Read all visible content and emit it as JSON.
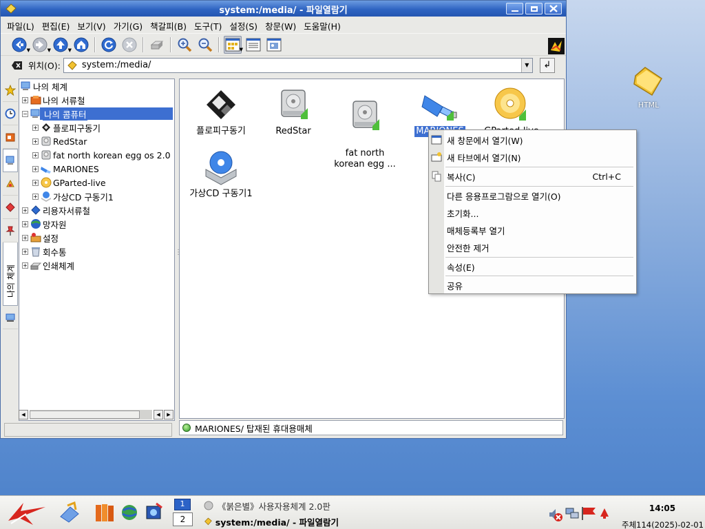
{
  "window": {
    "title": "system:/media/ - 파일열람기"
  },
  "menu": [
    "파일(L)",
    "편집(E)",
    "보기(V)",
    "가기(G)",
    "책갈피(B)",
    "도구(T)",
    "설정(S)",
    "창문(W)",
    "도움말(H)"
  ],
  "toolbar": {
    "icons": [
      "back-icon",
      "forward-icon",
      "up-icon",
      "home-icon",
      "reload-icon",
      "stop-icon",
      "print-icon",
      "zoom-in-icon",
      "zoom-out-icon",
      "icon-view-icon",
      "detail-view-icon",
      "preview-icon"
    ]
  },
  "location": {
    "label": "위치(O):",
    "value": "system:/media/"
  },
  "sidetab": {
    "label": "나의 체계"
  },
  "tree": {
    "root": "나의 체계",
    "items": [
      {
        "label": "나의 서류철",
        "depth": 1
      },
      {
        "label": "나의 콤퓨터",
        "depth": 1,
        "selected": true
      },
      {
        "label": "플로피구동기",
        "depth": 2
      },
      {
        "label": "RedStar",
        "depth": 2
      },
      {
        "label": "fat north korean egg os 2.0",
        "depth": 2
      },
      {
        "label": "MARIONES",
        "depth": 2
      },
      {
        "label": "GParted-live",
        "depth": 2
      },
      {
        "label": "가상CD 구동기1",
        "depth": 2
      },
      {
        "label": "리용자서류철",
        "depth": 1
      },
      {
        "label": "망자원",
        "depth": 1
      },
      {
        "label": "설정",
        "depth": 1
      },
      {
        "label": "회수통",
        "depth": 1
      },
      {
        "label": "인쇄체계",
        "depth": 1
      }
    ]
  },
  "icons": [
    {
      "label": "플로피구동기",
      "icon": "floppy-icon"
    },
    {
      "label": "RedStar",
      "icon": "hard-disk-icon"
    },
    {
      "label": "fat north\nkorean egg ...",
      "icon": "hard-disk-icon"
    },
    {
      "label": "MARIONES",
      "icon": "usb-drive-icon",
      "selected": true
    },
    {
      "label": "GParted-live",
      "icon": "cdrom-icon"
    },
    {
      "label": "가상CD 구동기1",
      "icon": "virtual-cd-icon"
    }
  ],
  "status": {
    "text": "MARIONES/  탑재된 휴대용매체"
  },
  "context_menu": {
    "items": [
      {
        "label": "새 창문에서 열기(W)",
        "icon": "new-window-icon"
      },
      {
        "label": "새 타브에서 열기(N)",
        "icon": "new-tab-icon"
      },
      {
        "label": "복사(C)",
        "shortcut": "Ctrl+C",
        "icon": "copy-icon"
      },
      {
        "label": "다른 응용프로그람으로 열기(O)"
      },
      {
        "label": "초기화..."
      },
      {
        "label": "매체등록부 열기"
      },
      {
        "label": "안전한 제거"
      },
      {
        "label": "속성(E)"
      },
      {
        "label": "공유"
      }
    ]
  },
  "desktop": {
    "icon_label": "HTML"
  },
  "taskbar": {
    "pager": [
      "1",
      "2"
    ],
    "tasks": [
      "《붉은별》사용자용체계 2.0판",
      "system:/media/ - 파일열람기"
    ],
    "clock": "14:05",
    "date": "주체114(2025)-02-01"
  },
  "colors": {
    "selection": "#3d6fd1",
    "titlebar": "#2f64c2"
  }
}
